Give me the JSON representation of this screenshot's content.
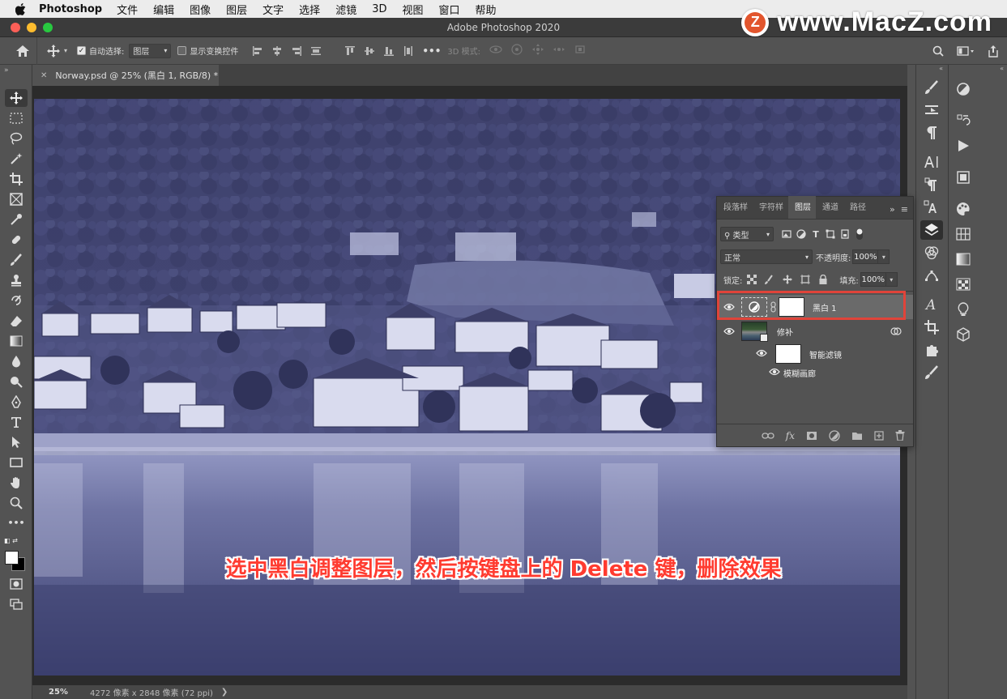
{
  "menubar": {
    "app_name": "Photoshop",
    "items": [
      "文件",
      "编辑",
      "图像",
      "图层",
      "文字",
      "选择",
      "滤镜",
      "3D",
      "视图",
      "窗口",
      "帮助"
    ]
  },
  "watermark": {
    "badge": "Z",
    "text": "www.MacZ.com"
  },
  "window": {
    "title": "Adobe Photoshop 2020"
  },
  "options_bar": {
    "auto_select_label": "自动选择:",
    "auto_select_checked": true,
    "auto_select_value": "图层",
    "show_transform_label": "显示变换控件",
    "show_transform_checked": false,
    "mode_3d_label": "3D 模式:"
  },
  "document_tab": {
    "title": "Norway.psd @ 25% (黑白 1, RGB/8) *"
  },
  "status_bar": {
    "zoom": "25%",
    "info": "4272 像素 x 2848 像素 (72 ppi)"
  },
  "layers_panel": {
    "tabs": [
      "段落样",
      "字符样",
      "图层",
      "通道",
      "路径"
    ],
    "active_tab": "图层",
    "filter_kind": "类型",
    "blend_mode": "正常",
    "opacity_label": "不透明度:",
    "opacity_value": "100%",
    "lock_label": "锁定:",
    "fill_label": "填充:",
    "fill_value": "100%",
    "layers": [
      {
        "name": "黑白 1",
        "type": "adjustment",
        "selected": true,
        "visible": true
      },
      {
        "name": "修补",
        "type": "smart-object",
        "selected": false,
        "visible": true
      }
    ],
    "smart_filters_label": "智能滤镜",
    "smart_filter_items": [
      "模糊画廊"
    ]
  },
  "caption": {
    "text": "选中黑白调整图层，然后按键盘上的 Delete 键，删除效果"
  },
  "colors": {
    "selection_highlight": "#e0443a",
    "caption": "#ff3b30",
    "photo_tint": "#4b5080"
  }
}
